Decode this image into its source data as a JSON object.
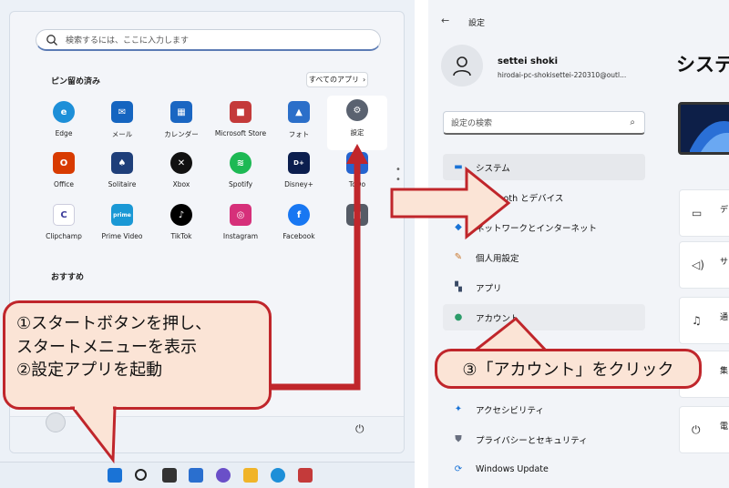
{
  "start_menu": {
    "search_placeholder": "検索するには、ここに入力します",
    "pinned_title": "ピン留め済み",
    "all_apps_label": "すべてのアプリ",
    "recommended_title": "おすすめ",
    "pinned_apps": [
      {
        "label": "Edge",
        "icon": "edge-icon",
        "color": "#1d8fd8"
      },
      {
        "label": "メール",
        "icon": "mail-icon",
        "color": "#1565c0"
      },
      {
        "label": "カレンダー",
        "icon": "calendar-icon",
        "color": "#1a66c2"
      },
      {
        "label": "Microsoft Store",
        "icon": "store-icon",
        "color": "#c43a3a"
      },
      {
        "label": "フォト",
        "icon": "photos-icon",
        "color": "#2b6fc9"
      },
      {
        "label": "設定",
        "icon": "gear-icon",
        "color": "#5a6270"
      },
      {
        "label": "Office",
        "icon": "office-icon",
        "color": "#d83b01"
      },
      {
        "label": "Solitaire",
        "icon": "solitaire-icon",
        "color": "#1f3f7a"
      },
      {
        "label": "Xbox",
        "icon": "xbox-icon",
        "color": "#111111"
      },
      {
        "label": "Spotify",
        "icon": "spotify-icon",
        "color": "#1db954"
      },
      {
        "label": "Disney+",
        "icon": "disney-icon",
        "color": "#0b1e4e"
      },
      {
        "label": "ToDo",
        "icon": "todo-icon",
        "color": "#2564cf"
      },
      {
        "label": "Clipchamp",
        "icon": "clipchamp-icon",
        "color": "#3b3b9a"
      },
      {
        "label": "Prime Video",
        "icon": "prime-video-icon",
        "color": "#1a98d5"
      },
      {
        "label": "TikTok",
        "icon": "tiktok-icon",
        "color": "#000000"
      },
      {
        "label": "Instagram",
        "icon": "instagram-icon",
        "color": "#d6307a"
      },
      {
        "label": "Facebook",
        "icon": "facebook-icon",
        "color": "#1877f2"
      }
    ]
  },
  "settings": {
    "title": "設定",
    "user_name": "settei shoki",
    "user_email": "hirodai-pc-shokisettei-220310@outl...",
    "search_placeholder": "設定の検索",
    "heading": "システ",
    "nav_items": [
      {
        "label": "システム",
        "icon": "system-icon"
      },
      {
        "label": "Bluetooth とデバイス",
        "icon": "bluetooth-icon"
      },
      {
        "label": "ネットワークとインターネット",
        "icon": "network-icon"
      },
      {
        "label": "個人用設定",
        "icon": "brush-icon"
      },
      {
        "label": "アプリ",
        "icon": "apps-icon"
      },
      {
        "label": "アカウント",
        "icon": "account-icon"
      },
      {
        "label": "アクセシビリティ",
        "icon": "accessibility-icon"
      },
      {
        "label": "プライバシーとセキュリティ",
        "icon": "shield-icon"
      },
      {
        "label": "Windows Update",
        "icon": "update-icon"
      }
    ],
    "cards": [
      {
        "icon": "display-icon",
        "text": "デ"
      },
      {
        "icon": "sound-icon",
        "text": "サ"
      },
      {
        "icon": "notification-icon",
        "text": "通"
      },
      {
        "icon": "focus-icon",
        "text": "集"
      },
      {
        "icon": "power-icon",
        "text": "電"
      }
    ]
  },
  "callouts": {
    "left_line1": "①スタートボタンを押し、",
    "left_line2": "スタートメニューを表示",
    "left_line3": "②設定アプリを起動",
    "right": "③「アカウント」をクリック"
  },
  "colors": {
    "callout_fill": "#fbe4d6",
    "callout_border": "#c0262b",
    "accent": "#005fb8"
  }
}
